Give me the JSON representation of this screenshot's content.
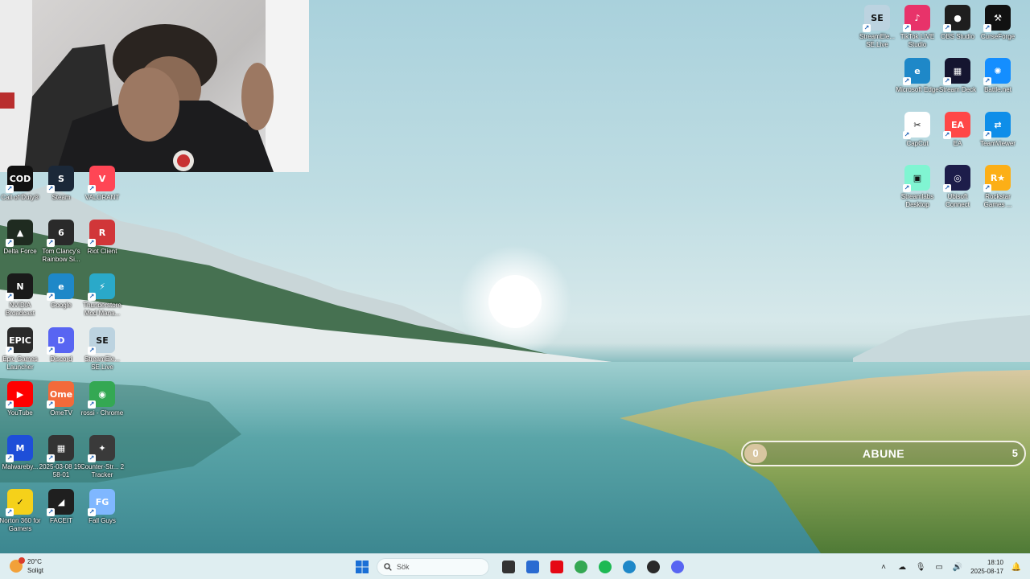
{
  "desktop": {
    "left_icons": [
      {
        "label": "Call of Duty®",
        "icon": "call-of-duty-icon",
        "color": "#111111",
        "glyph": "COD"
      },
      {
        "label": "Steam",
        "icon": "steam-icon",
        "color": "#1b2838",
        "glyph": "S"
      },
      {
        "label": "VALORANT",
        "icon": "valorant-icon",
        "color": "#ff4655",
        "glyph": "V"
      },
      {
        "label": "Delta Force",
        "icon": "delta-force-icon",
        "color": "#1f2b20",
        "glyph": "▲"
      },
      {
        "label": "Tom Clancy's Rainbow Si...",
        "icon": "rainbow-six-icon",
        "color": "#2a2a2a",
        "glyph": "6"
      },
      {
        "label": "Riot Client",
        "icon": "riot-client-icon",
        "color": "#d13639",
        "glyph": "R"
      },
      {
        "label": "NVIDIA Broadcast",
        "icon": "nvidia-broadcast-icon",
        "color": "#1a1a1a",
        "glyph": "N"
      },
      {
        "label": "Google",
        "icon": "edge-google-icon",
        "color": "#1e88c8",
        "glyph": "e"
      },
      {
        "label": "Thunderstore Mod Mana...",
        "icon": "thunderstore-icon",
        "color": "#2aa9c9",
        "glyph": "⚡"
      },
      {
        "label": "Epic Games Launcher",
        "icon": "epic-games-icon",
        "color": "#2a2a2a",
        "glyph": "EPIC"
      },
      {
        "label": "Discord",
        "icon": "discord-icon",
        "color": "#5865f2",
        "glyph": "D"
      },
      {
        "label": "StreamEle... SE.Live",
        "icon": "streamelements-icon",
        "color": "#bcd3e0",
        "glyph": "SE"
      },
      {
        "label": "YouTube",
        "icon": "youtube-icon",
        "color": "#ff0000",
        "glyph": "▶"
      },
      {
        "label": "OmeTV",
        "icon": "ometv-icon",
        "color": "#f36a3a",
        "glyph": "Ome"
      },
      {
        "label": "rossi - Chrome",
        "icon": "chrome-icon",
        "color": "#34a853",
        "glyph": "◉"
      },
      {
        "label": "Malwareby...",
        "icon": "malwarebytes-icon",
        "color": "#1e4fd8",
        "glyph": "M"
      },
      {
        "label": "2025-03-08 19-58-01",
        "icon": "video-file-icon",
        "color": "#333333",
        "glyph": "▦"
      },
      {
        "label": "Counter-Str... 2 Tracker",
        "icon": "cs2-tracker-icon",
        "color": "#3a3a3a",
        "glyph": "✦"
      },
      {
        "label": "Norton 360 for Gamers",
        "icon": "norton-icon",
        "color": "#f5d11a",
        "glyph": "✓"
      },
      {
        "label": "FACEIT",
        "icon": "faceit-icon",
        "color": "#1f1f1f",
        "glyph": "◢"
      },
      {
        "label": "Fall Guys",
        "icon": "fall-guys-icon",
        "color": "#7fb7ff",
        "glyph": "FG"
      }
    ],
    "right_icons": [
      {
        "label": "StreamEle... SE.Live",
        "icon": "streamelements-icon",
        "color": "#bcd3e0",
        "glyph": "SE"
      },
      {
        "label": "TikTok LIVE Studio",
        "icon": "tiktok-live-icon",
        "color": "#e8336a",
        "glyph": "♪"
      },
      {
        "label": "OBS Studio",
        "icon": "obs-icon",
        "color": "#1e1e1e",
        "glyph": "●"
      },
      {
        "label": "CurseForge",
        "icon": "curseforge-icon",
        "color": "#111111",
        "glyph": "⚒"
      },
      {
        "label": "Microsoft Edge",
        "icon": "edge-icon",
        "color": "#1e88c8",
        "glyph": "e"
      },
      {
        "label": "Stream Deck",
        "icon": "stream-deck-icon",
        "color": "#151530",
        "glyph": "▦"
      },
      {
        "label": "Battle.net",
        "icon": "battlenet-icon",
        "color": "#148eff",
        "glyph": "✺"
      },
      {
        "label": "CapCut",
        "icon": "capcut-icon",
        "color": "#ffffff",
        "glyph": "✂"
      },
      {
        "label": "EA",
        "icon": "ea-icon",
        "color": "#ff4747",
        "glyph": "EA"
      },
      {
        "label": "TeamViewer",
        "icon": "teamviewer-icon",
        "color": "#0e8ee9",
        "glyph": "⇄"
      },
      {
        "label": "Streamlabs Desktop",
        "icon": "streamlabs-icon",
        "color": "#80f5d2",
        "glyph": "▣"
      },
      {
        "label": "Ubisoft Connect",
        "icon": "ubisoft-icon",
        "color": "#1d1d4a",
        "glyph": "◎"
      },
      {
        "label": "Rockstar Games ...",
        "icon": "rockstar-icon",
        "color": "#fcaf17",
        "glyph": "R★"
      }
    ]
  },
  "subscriber_widget": {
    "label": "ABUNE",
    "current": "0",
    "goal": "5",
    "progress_fraction": 0.0,
    "fill_color": "#d8c6a0"
  },
  "taskbar": {
    "weather": {
      "temp": "20°C",
      "condition": "Soligt"
    },
    "search_placeholder": "Sök",
    "pinned": [
      {
        "name": "start-button",
        "icon": "windows-icon",
        "color": "#1a6fd6"
      },
      {
        "name": "task-view-button",
        "icon": "task-view-icon",
        "color": "#333333"
      },
      {
        "name": "ms-store-button",
        "icon": "store-icon",
        "color": "#2a6bd1"
      },
      {
        "name": "netflix-button",
        "icon": "netflix-icon",
        "color": "#e50914"
      },
      {
        "name": "chrome-button",
        "icon": "chrome-icon",
        "color": "#34a853"
      },
      {
        "name": "spotify-button",
        "icon": "spotify-icon",
        "color": "#1db954"
      },
      {
        "name": "edge-button",
        "icon": "edge-icon",
        "color": "#1e88c8"
      },
      {
        "name": "obs-button",
        "icon": "obs-icon",
        "color": "#2a2a2a"
      },
      {
        "name": "discord-button",
        "icon": "discord-icon",
        "color": "#5865f2"
      }
    ],
    "clock": {
      "time": "18:10",
      "date": "2025-08-17"
    }
  }
}
